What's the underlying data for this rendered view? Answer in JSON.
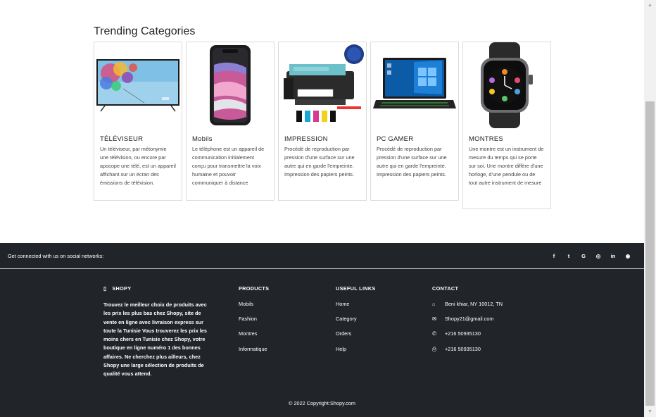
{
  "trending": {
    "title": "Trending Categories",
    "cards": [
      {
        "title": "TÉLÉVISEUR",
        "text": "Un téléviseur, par métonymie une télévision, ou encore par apocope une télé, est un appareil affichant sur un écran des émissions de télévision."
      },
      {
        "title": "Mobils",
        "text": "Le téléphone est un appareil de communication initialement conçu pour transmettre la voix humaine et pouvoir communiquer à distance"
      },
      {
        "title": "IMPRESSION",
        "text": "Procédé de reproduction par pression d'une surface sur une autre qui en garde l'empreinte. Impression des papiers peints."
      },
      {
        "title": "PC GAMER",
        "text": "Procédé de reproduction par pression d'une surface sur une autre qui en garde l'empreinte. Impression des papiers peints."
      },
      {
        "title": "MONTRES",
        "text": "Une montre est un instrument de mesure du temps qui se porte sur soi. Une montre diffère d'une horloge, d'une pendule ou de tout autre instrument de mesure"
      }
    ]
  },
  "footer": {
    "social_label": "Get connected with us on social networks:",
    "social_icons": [
      "facebook-icon",
      "twitter-icon",
      "google-icon",
      "instagram-icon",
      "linkedin-icon",
      "github-icon"
    ],
    "social_glyphs": [
      "f",
      "t",
      "G",
      "◎",
      "in",
      "◉"
    ],
    "brand": {
      "icon_glyph": "▯",
      "name": "SHOPY",
      "about": "Trouvez le meilleur choix de produits avec les prix les plus bas chez Shopy, site de vente en ligne avec livraison express sur toute la Tunisie Vous trouverez les prix les moins chers en Tunisie chez Shopy, votre boutique en ligne numéro 1 des bonnes affaires. Ne cherchez plus ailleurs, chez Shopy une large sélection de produits de qualité vous attend."
    },
    "products": {
      "title": "PRODUCTS",
      "items": [
        "Mobils",
        "Fashion",
        "Montres",
        "Informatique"
      ]
    },
    "useful_links": {
      "title": "USEFUL LINKS",
      "items": [
        "Home",
        "Category",
        "Orders",
        "Help"
      ]
    },
    "contact": {
      "title": "CONTACT",
      "items": [
        {
          "icon": "home-icon",
          "glyph": "⌂",
          "text": "Beni khiar, NY 10012, TN"
        },
        {
          "icon": "envelope-icon",
          "glyph": "✉",
          "text": "Shopy21@gmail.com"
        },
        {
          "icon": "phone-icon",
          "glyph": "✆",
          "text": "+216 50935130"
        },
        {
          "icon": "print-icon",
          "glyph": "⎙",
          "text": "+216 50935130"
        }
      ]
    },
    "copyright": "© 2022 Copyright:Shopy.com"
  },
  "colors": {
    "footer_bg": "#212529",
    "scrollbar_thumb": "#c1c1c1"
  }
}
